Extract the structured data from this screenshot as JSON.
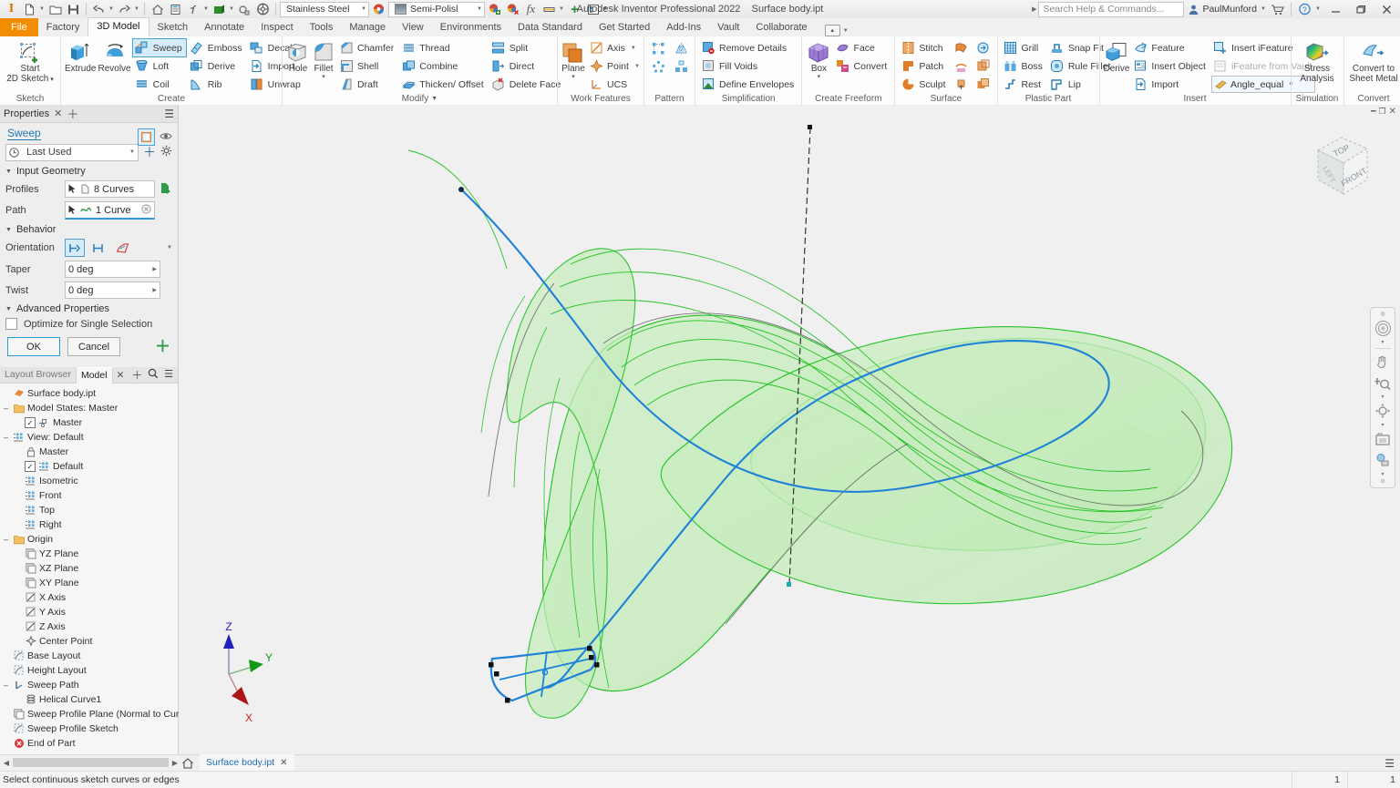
{
  "titlebar": {
    "app_title": "Autodesk Inventor Professional 2022",
    "document_title": "Surface body.ipt",
    "material": "Stainless Steel",
    "appearance": "Semi-Polisl",
    "search_placeholder": "Search Help & Commands...",
    "user": "PaulMunford",
    "qat": [
      {
        "name": "inventor-logo-icon",
        "glyph": "I"
      },
      {
        "name": "new-file-icon",
        "glyph": "file"
      },
      {
        "name": "open-file-icon",
        "glyph": "folder"
      },
      {
        "name": "save-icon",
        "glyph": "save"
      },
      {
        "name": "undo-icon",
        "glyph": "undo"
      },
      {
        "name": "redo-icon",
        "glyph": "redo"
      },
      {
        "name": "home-icon",
        "glyph": "home"
      },
      {
        "name": "sheet-icon",
        "glyph": "sheet"
      },
      {
        "name": "parameters-icon",
        "glyph": "fx-params"
      },
      {
        "name": "material-swatch-icon",
        "glyph": "material"
      },
      {
        "name": "appearance-select-icon",
        "glyph": "appearance"
      },
      {
        "name": "wheel-icon",
        "glyph": "wheel"
      }
    ],
    "window_buttons": [
      "minimize",
      "restore",
      "close"
    ]
  },
  "ribbon": {
    "tabs": [
      {
        "label": "File",
        "active": false,
        "file": true
      },
      {
        "label": "Factory",
        "active": false
      },
      {
        "label": "3D Model",
        "active": true
      },
      {
        "label": "Sketch",
        "active": false
      },
      {
        "label": "Annotate",
        "active": false
      },
      {
        "label": "Inspect",
        "active": false
      },
      {
        "label": "Tools",
        "active": false
      },
      {
        "label": "Manage",
        "active": false
      },
      {
        "label": "View",
        "active": false
      },
      {
        "label": "Environments",
        "active": false
      },
      {
        "label": "Data Standard",
        "active": false
      },
      {
        "label": "Get Started",
        "active": false
      },
      {
        "label": "Add-Ins",
        "active": false
      },
      {
        "label": "Vault",
        "active": false
      },
      {
        "label": "Collaborate",
        "active": false
      }
    ],
    "panels": [
      {
        "name": "sketch",
        "label": "Sketch",
        "big": [
          {
            "label": "Start\n2D Sketch",
            "icon": "start-2d-sketch-icon",
            "dropdown": true
          }
        ],
        "cols": []
      },
      {
        "name": "create",
        "label": "Create",
        "big": [
          {
            "label": "Extrude",
            "icon": "extrude-icon"
          },
          {
            "label": "Revolve",
            "icon": "revolve-icon"
          }
        ],
        "cols": [
          [
            {
              "label": "Sweep",
              "icon": "sweep-icon",
              "selected": true
            },
            {
              "label": "Loft",
              "icon": "loft-icon"
            },
            {
              "label": "Coil",
              "icon": "coil-icon"
            }
          ],
          [
            {
              "label": "Emboss",
              "icon": "emboss-icon"
            },
            {
              "label": "Derive",
              "icon": "derive-icon"
            },
            {
              "label": "Rib",
              "icon": "rib-icon"
            }
          ],
          [
            {
              "label": "Decal",
              "icon": "decal-icon"
            },
            {
              "label": "Import",
              "icon": "import-icon"
            },
            {
              "label": "Unwrap",
              "icon": "unwrap-icon"
            }
          ]
        ]
      },
      {
        "name": "modify",
        "label": "Modify",
        "label_dropdown": true,
        "big": [
          {
            "label": "Hole",
            "icon": "hole-icon"
          },
          {
            "label": "Fillet",
            "icon": "fillet-icon",
            "dropdown": true
          }
        ],
        "cols": [
          [
            {
              "label": "Chamfer",
              "icon": "chamfer-icon"
            },
            {
              "label": "Shell",
              "icon": "shell-icon"
            },
            {
              "label": "Draft",
              "icon": "draft-icon"
            }
          ],
          [
            {
              "label": "Thread",
              "icon": "thread-icon"
            },
            {
              "label": "Combine",
              "icon": "combine-icon"
            },
            {
              "label": "Thicken/ Offset",
              "icon": "thicken-offset-icon"
            }
          ],
          [
            {
              "label": "Split",
              "icon": "split-icon"
            },
            {
              "label": "Direct",
              "icon": "direct-icon"
            },
            {
              "label": "Delete Face",
              "icon": "delete-face-icon"
            }
          ]
        ]
      },
      {
        "name": "work-features",
        "label": "Work Features",
        "big": [
          {
            "label": "Plane",
            "icon": "plane-icon",
            "dropdown": true
          }
        ],
        "cols": [
          [
            {
              "label": "Axis",
              "icon": "axis-icon",
              "dropdown": true
            },
            {
              "label": "Point",
              "icon": "point-icon",
              "dropdown": true
            },
            {
              "label": "UCS",
              "icon": "ucs-icon"
            }
          ]
        ]
      },
      {
        "name": "pattern",
        "label": "Pattern",
        "icon_grid": [
          "rectangular-pattern-icon",
          "mirror-icon",
          "circular-pattern-icon",
          "sketch-driven-pattern-icon"
        ]
      },
      {
        "name": "simplification",
        "label": "Simplification",
        "cols": [
          [
            {
              "label": "Remove Details",
              "icon": "remove-details-icon"
            },
            {
              "label": "Fill Voids",
              "icon": "fill-voids-icon"
            },
            {
              "label": "Define Envelopes",
              "icon": "define-envelopes-icon"
            }
          ]
        ]
      },
      {
        "name": "create-freeform",
        "label": "Create Freeform",
        "big": [
          {
            "label": "Box",
            "icon": "freeform-box-icon",
            "dropdown": true
          }
        ],
        "cols": [
          [
            {
              "label": "Face",
              "icon": "freeform-face-icon"
            },
            {
              "label": "Convert",
              "icon": "freeform-convert-icon"
            }
          ]
        ]
      },
      {
        "name": "surface",
        "label": "Surface",
        "cols": [
          [
            {
              "label": "Stitch",
              "icon": "stitch-icon"
            },
            {
              "label": "Patch",
              "icon": "patch-icon"
            },
            {
              "label": "Sculpt",
              "icon": "sculpt-icon"
            }
          ],
          [
            {
              "label": "",
              "icon": "trim-surface-icon"
            },
            {
              "label": "",
              "icon": "extend-surface-icon"
            },
            {
              "label": "",
              "icon": "ruled-surface-icon"
            }
          ],
          [
            {
              "label": "",
              "icon": "replace-face-icon"
            },
            {
              "label": "",
              "icon": "delete-face-surface-icon"
            },
            {
              "label": "",
              "icon": "copy-object-icon"
            }
          ]
        ]
      },
      {
        "name": "plastic-part",
        "label": "Plastic Part",
        "cols": [
          [
            {
              "label": "Grill",
              "icon": "grill-icon"
            },
            {
              "label": "Boss",
              "icon": "boss-icon"
            },
            {
              "label": "Rest",
              "icon": "rest-icon"
            }
          ],
          [
            {
              "label": "Snap Fit",
              "icon": "snap-fit-icon"
            },
            {
              "label": "Rule Fillet",
              "icon": "rule-fillet-icon"
            },
            {
              "label": "Lip",
              "icon": "lip-icon"
            }
          ]
        ]
      },
      {
        "name": "insert",
        "label": "Insert",
        "big": [
          {
            "label": "Derive",
            "icon": "derive-big-icon"
          }
        ],
        "cols": [
          [
            {
              "label": "Feature",
              "icon": "insert-feature-icon"
            },
            {
              "label": "Insert Object",
              "icon": "insert-object-icon"
            },
            {
              "label": "Import",
              "icon": "insert-import-icon"
            }
          ],
          [
            {
              "label": "Insert iFeature",
              "icon": "insert-ifeature-icon"
            },
            {
              "label": "iFeature from Vault",
              "icon": "ifeature-vault-icon",
              "disabled": true
            }
          ]
        ],
        "ifeature_select": "Angle_equal"
      },
      {
        "name": "simulation",
        "label": "Simulation",
        "big": [
          {
            "label": "Stress\nAnalysis",
            "icon": "stress-analysis-icon"
          }
        ]
      },
      {
        "name": "convert",
        "label": "Convert",
        "big": [
          {
            "label": "Convert to\nSheet Metal",
            "icon": "convert-sheet-metal-icon"
          }
        ]
      }
    ]
  },
  "properties_panel": {
    "tab_title": "Properties",
    "feature_name": "Sweep",
    "preset": "Last Used",
    "sections": {
      "input_geometry": {
        "title": "Input Geometry",
        "rows": [
          {
            "label": "Profiles",
            "value": "8 Curves",
            "icon": "profile-curve-icon"
          },
          {
            "label": "Path",
            "value": "1 Curve",
            "icon": "path-curve-icon"
          }
        ]
      },
      "behavior": {
        "title": "Behavior",
        "orientation_label": "Orientation",
        "orientation_modes": [
          "path-orientation-icon",
          "parallel-orientation-icon",
          "guide-surface-icon"
        ],
        "taper_label": "Taper",
        "taper_value": "0 deg",
        "twist_label": "Twist",
        "twist_value": "0 deg"
      },
      "advanced": {
        "title": "Advanced Properties",
        "optimize_label": "Optimize for Single Selection",
        "optimize_checked": false
      }
    },
    "ok_label": "OK",
    "cancel_label": "Cancel"
  },
  "browser": {
    "tabs": [
      {
        "label": "Layout Browser",
        "active": false
      },
      {
        "label": "Model",
        "active": true
      }
    ],
    "tree": [
      {
        "label": "Surface body.ipt",
        "depth": 0,
        "icon": "part-doc-icon"
      },
      {
        "label": "Model States: Master",
        "depth": 0,
        "icon": "folder-icon",
        "expander": "minus"
      },
      {
        "label": "Master",
        "depth": 1,
        "icon": "model-state-icon",
        "check": true
      },
      {
        "label": "View: Default",
        "depth": 0,
        "icon": "view-icon",
        "expander": "minus"
      },
      {
        "label": "Master",
        "depth": 1,
        "icon": "lock-icon"
      },
      {
        "label": "Default",
        "depth": 1,
        "icon": "view-icon",
        "check": true
      },
      {
        "label": "Isometric",
        "depth": 1,
        "icon": "view-icon"
      },
      {
        "label": "Front",
        "depth": 1,
        "icon": "view-icon"
      },
      {
        "label": "Top",
        "depth": 1,
        "icon": "view-icon"
      },
      {
        "label": "Right",
        "depth": 1,
        "icon": "view-icon"
      },
      {
        "label": "Origin",
        "depth": 0,
        "icon": "folder-icon",
        "expander": "minus"
      },
      {
        "label": "YZ Plane",
        "depth": 1,
        "icon": "plane-tree-icon"
      },
      {
        "label": "XZ Plane",
        "depth": 1,
        "icon": "plane-tree-icon"
      },
      {
        "label": "XY Plane",
        "depth": 1,
        "icon": "plane-tree-icon"
      },
      {
        "label": "X Axis",
        "depth": 1,
        "icon": "axis-tree-icon"
      },
      {
        "label": "Y Axis",
        "depth": 1,
        "icon": "axis-tree-icon"
      },
      {
        "label": "Z Axis",
        "depth": 1,
        "icon": "axis-tree-icon"
      },
      {
        "label": "Center Point",
        "depth": 1,
        "icon": "center-point-icon"
      },
      {
        "label": "Base Layout",
        "depth": 0,
        "icon": "sketch-tree-icon"
      },
      {
        "label": "Height Layout",
        "depth": 0,
        "icon": "sketch-tree-icon"
      },
      {
        "label": "Sweep Path",
        "depth": 0,
        "icon": "sweep-path-icon",
        "expander": "minus"
      },
      {
        "label": "Helical Curve1",
        "depth": 1,
        "icon": "helical-curve-icon"
      },
      {
        "label": "Sweep Profile Plane (Normal to Curve at Poi",
        "depth": 0,
        "icon": "plane-tree-icon"
      },
      {
        "label": "Sweep Profile Sketch",
        "depth": 0,
        "icon": "sketch-tree-icon"
      },
      {
        "label": "End of Part",
        "depth": 0,
        "icon": "end-of-part-icon"
      }
    ]
  },
  "viewport": {
    "viewcube_faces": {
      "top": "TOP",
      "front": "FRONT",
      "left": "LEFT"
    },
    "axis_triad": {
      "x": "X",
      "y": "Y",
      "z": "Z"
    },
    "colors": {
      "surface_fill": "#c8edc0",
      "surface_edge": "#00d000",
      "path_curve": "#1f82d8",
      "work_axis": "#222222",
      "x_axis": "#cc2222",
      "y_axis": "#119911",
      "z_axis": "#2222bb",
      "accent": "#2e9bd6"
    },
    "nav_tools": [
      "full-navigation-wheel-icon",
      "pan-icon",
      "zoom-icon",
      "orbit-icon",
      "look-at-icon",
      "display-style-icon"
    ]
  },
  "bottom": {
    "home_icon": "home-icon",
    "doc_tab": "Surface body.ipt",
    "status_message": "Select continuous sketch curves or edges",
    "status_cells": [
      "1",
      "1"
    ]
  }
}
